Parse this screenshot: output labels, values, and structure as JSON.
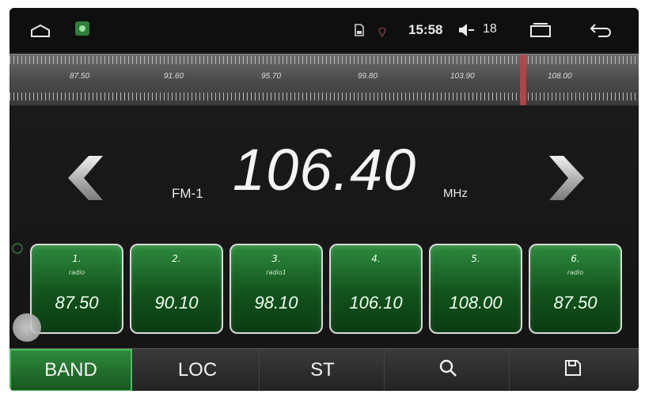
{
  "status_bar": {
    "time": "15:58",
    "volume": "18",
    "icons": [
      "home-icon",
      "android-app-icon",
      "sd-card-icon",
      "gps-icon",
      "volume-icon",
      "recent-apps-icon",
      "back-icon"
    ]
  },
  "tuner_scale": {
    "labels": [
      "87.50",
      "91.60",
      "95.70",
      "99.80",
      "103.90",
      "108.00"
    ],
    "needle_frequency": 106.4
  },
  "main": {
    "band": "FM-1",
    "frequency": "106.40",
    "unit": "MHz"
  },
  "presets": [
    {
      "num": "1.",
      "name": "radio",
      "freq": "87.50"
    },
    {
      "num": "2.",
      "name": "",
      "freq": "90.10"
    },
    {
      "num": "3.",
      "name": "radio1",
      "freq": "98.10"
    },
    {
      "num": "4.",
      "name": "",
      "freq": "106.10"
    },
    {
      "num": "5.",
      "name": "",
      "freq": "108.00"
    },
    {
      "num": "6.",
      "name": "radio",
      "freq": "87.50"
    }
  ],
  "bottom_bar": {
    "band_label": "BAND",
    "loc_label": "LOC",
    "st_label": "ST",
    "search_icon": "search-icon",
    "save_icon": "save-icon"
  },
  "colors": {
    "accent_green": "#1f7a2e",
    "needle": "#b24848"
  }
}
